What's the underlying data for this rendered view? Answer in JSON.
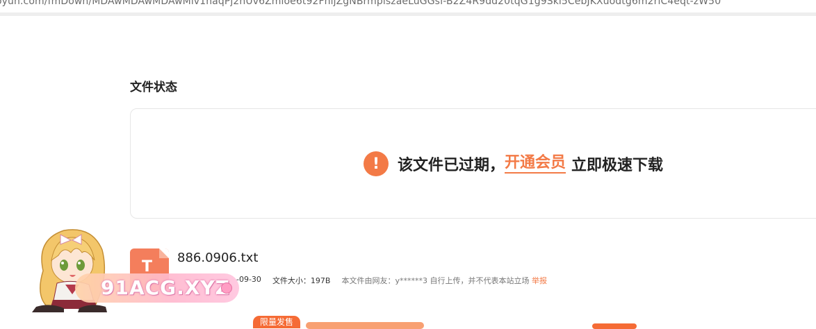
{
  "browser": {
    "url": "oyun.com/fmDown/MDAwMDAwMDAwMlv1naqPj2nUv6Zmloe6t92FnljZgNBrmpiszaeLuGGsf-B2Z4R9dd20tqG1g9Skl5CebJKXuodtg6m2rlC4eqt-zW50"
  },
  "page": {
    "section_title": "文件状态",
    "status_icon": "!",
    "status_text": "该文件已过期，",
    "vip_link": "开通会员",
    "download_text": "立即极速下载"
  },
  "file": {
    "icon_letter": "T",
    "name": "886.0906.txt",
    "date_fragment": "-09-30",
    "size_label": "文件大小：197B",
    "uploader_text": "本文件由网友：y******3 自行上传，并不代表本站立场",
    "report_label": "举报"
  },
  "overlay": {
    "watermark": "91ACG.XYZ"
  },
  "promo": {
    "tag": "限量发售"
  },
  "colors": {
    "accent": "#f37a46",
    "file_icon": "#f47e5c"
  }
}
